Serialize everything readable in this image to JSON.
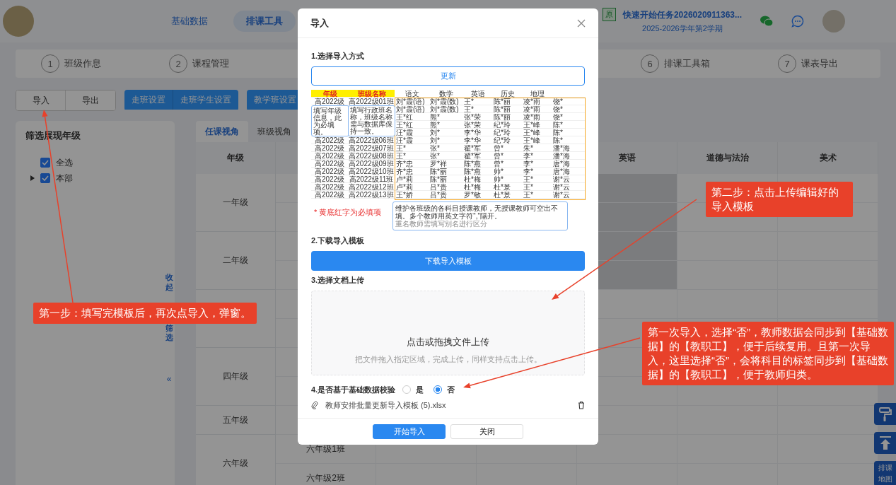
{
  "header": {
    "nav": [
      {
        "label": "基础数据",
        "selected": false
      },
      {
        "label": "排课工具",
        "selected": true
      }
    ],
    "task_badge": "原",
    "task_title": "快速开始任务2026020911363...",
    "term": "2025-2026学年第2学期"
  },
  "steps": {
    "left": [
      {
        "number": "1",
        "label": "班级作息"
      },
      {
        "number": "2",
        "label": "课程管理"
      }
    ],
    "right": [
      {
        "number": "6",
        "label": "排课工具箱"
      },
      {
        "number": "7",
        "label": "课表导出"
      }
    ]
  },
  "toolbar": [
    {
      "kind": "plain",
      "buttons": [
        "导入",
        "导出"
      ]
    },
    {
      "kind": "primary",
      "buttons": [
        "走班设置",
        "走班学生设置"
      ]
    },
    {
      "kind": "primary",
      "buttons": [
        "教学班设置"
      ]
    }
  ],
  "filter": {
    "title": "筛选展现年级",
    "items": [
      {
        "label": "全选",
        "checked": true
      },
      {
        "label": "本部",
        "checked": true,
        "expanded": false
      }
    ],
    "collapse": [
      "收起",
      "筛选"
    ],
    "collapse_icon": "«"
  },
  "table": {
    "tabs": [
      {
        "label": "任课视角",
        "selected": true
      },
      {
        "label": "班级视角",
        "selected": false
      }
    ],
    "columns": [
      "年级",
      null,
      null,
      null,
      "英语",
      "道德与法治",
      "美术"
    ],
    "rows": [
      {
        "grade": "一年级",
        "kind": "double",
        "highlighted": true
      },
      {
        "grade": "二年级",
        "kind": "double",
        "highlighted": true
      },
      {
        "kind": "double",
        "highlighted": false
      },
      {
        "grade": "四年级",
        "kind": "double",
        "highlighted": false
      },
      {
        "grade": "五年级",
        "kind": "single",
        "highlighted": false
      },
      {
        "grade": "六年级",
        "kind": "double",
        "highlighted": false,
        "classes": [
          "六年级1班",
          "六年级2班"
        ]
      }
    ]
  },
  "float_buttons": [
    {
      "kind": "roller"
    },
    {
      "kind": "top"
    },
    {
      "kind": "map",
      "label": "排课地图"
    }
  ],
  "modal": {
    "title": "导入",
    "step1": {
      "label": "1.选择导入方式",
      "button": "更新"
    },
    "sample": {
      "columns": [
        {
          "label": "年级",
          "required": true
        },
        {
          "label": "班级名称",
          "required": true
        },
        {
          "label": "语文",
          "required": false
        },
        {
          "label": "数学",
          "required": false
        },
        {
          "label": "英语",
          "required": false
        },
        {
          "label": "历史",
          "required": false
        },
        {
          "label": "地理",
          "required": false
        },
        {
          "required": false
        }
      ],
      "rows": [
        {
          "grade": "高2022级",
          "class_name": "高2022级01班",
          "teachers": [
            "刘*霞(语)",
            "刘*霞(数)",
            "王*",
            "陈*丽",
            "凌*雨",
            "饶*"
          ]
        },
        {
          "teachers": [
            "刘*霞(语)",
            "刘*霞(数)",
            "王*",
            "陈*丽",
            "凌*雨",
            "饶*"
          ]
        },
        {
          "teachers": [
            "王*红",
            "熊*",
            "张*荣",
            "陈*丽",
            "凌*雨",
            "饶*"
          ]
        },
        {
          "teachers": [
            "王*红",
            "熊*",
            "张*荣",
            "纪*玲",
            "王*峰",
            "陈*"
          ]
        },
        {
          "teachers": [
            "汪*霞",
            "刘*",
            "李*华",
            "纪*玲",
            "王*峰",
            "陈*"
          ]
        },
        {
          "grade": "高2022级",
          "class_name": "高2022级06班",
          "teachers": [
            "汪*霞",
            "刘*",
            "李*华",
            "纪*玲",
            "王*峰",
            "陈*"
          ]
        },
        {
          "grade": "高2022级",
          "class_name": "高2022级07班",
          "teachers": [
            "王*",
            "张*",
            "翟*军",
            "曾*",
            "朱*",
            "潘*海"
          ]
        },
        {
          "grade": "高2022级",
          "class_name": "高2022级08班",
          "teachers": [
            "王*",
            "张*",
            "翟*军",
            "曾*",
            "李*",
            "潘*海"
          ]
        },
        {
          "grade": "高2022级",
          "class_name": "高2022级09班",
          "teachers": [
            "齐*忠",
            "罗*祥",
            "陈*燕",
            "曾*",
            "李*",
            "唐*海"
          ]
        },
        {
          "grade": "高2022级",
          "class_name": "高2022级10班",
          "teachers": [
            "齐*忠",
            "陈*丽",
            "陈*燕",
            "帅*",
            "李*",
            "唐*海"
          ]
        },
        {
          "grade": "高2022级",
          "class_name": "高2022级11班",
          "teachers": [
            "卢*莉",
            "陈*丽",
            "杜*梅",
            "帅*",
            "王*",
            "谢*云"
          ]
        },
        {
          "grade": "高2022级",
          "class_name": "高2022级12班",
          "teachers": [
            "卢*莉",
            "吕*贵",
            "杜*梅",
            "杜*景",
            "王*",
            "谢*云"
          ]
        },
        {
          "grade": "高2022级",
          "class_name": "高2022级13班",
          "teachers": [
            "王*娇",
            "吕*贵",
            "罗*敏",
            "杜*景",
            "王*",
            "谢*云"
          ]
        }
      ],
      "grade_tip": "填写年级信息，此为必填项。",
      "class_tip": "填写行政班名称，班级名称需与数据库保持一致。",
      "teacher_tip": "维护各班级的各科目授课教师，无授课教师可空出不填。多个教师用英文字符“,”隔开。",
      "teacher_tip_2": "重名教师需填写别名进行区分",
      "required_note": "* 黄底红字为必填项"
    },
    "step2": {
      "label": "2.下载导入模板",
      "button": "下载导入模板"
    },
    "step3": {
      "label": "3.选择文档上传",
      "upload_title": "点击或拖拽文件上传",
      "upload_hint": "把文件拖入指定区域，完成上传，同样支持点击上传。"
    },
    "step4": {
      "label": "4.是否基于基础数据校验",
      "options": [
        {
          "label": "是",
          "selected": false
        },
        {
          "label": "否",
          "selected": true
        }
      ]
    },
    "file": {
      "name": "教师安排批量更新导入模板 (5).xlsx"
    },
    "footer": [
      {
        "label": "开始导入",
        "kind": "primary"
      },
      {
        "label": "关闭",
        "kind": "default"
      }
    ]
  },
  "annotations": [
    {
      "kind": "step1",
      "text": "第一步：填写完模板后，再次点导入，弹窗。"
    },
    {
      "kind": "step2",
      "text": "第二步：点击上传编辑好的导入模板"
    },
    {
      "kind": "step3",
      "text": "第一次导入，选择“否”，教师数据会同步到【基础数据】的【教职工】，便于后续复用。且第一次导入，这里选择“否”，会将科目的标签同步到【基础数据】的【教职工】，便于教师归类。"
    }
  ]
}
